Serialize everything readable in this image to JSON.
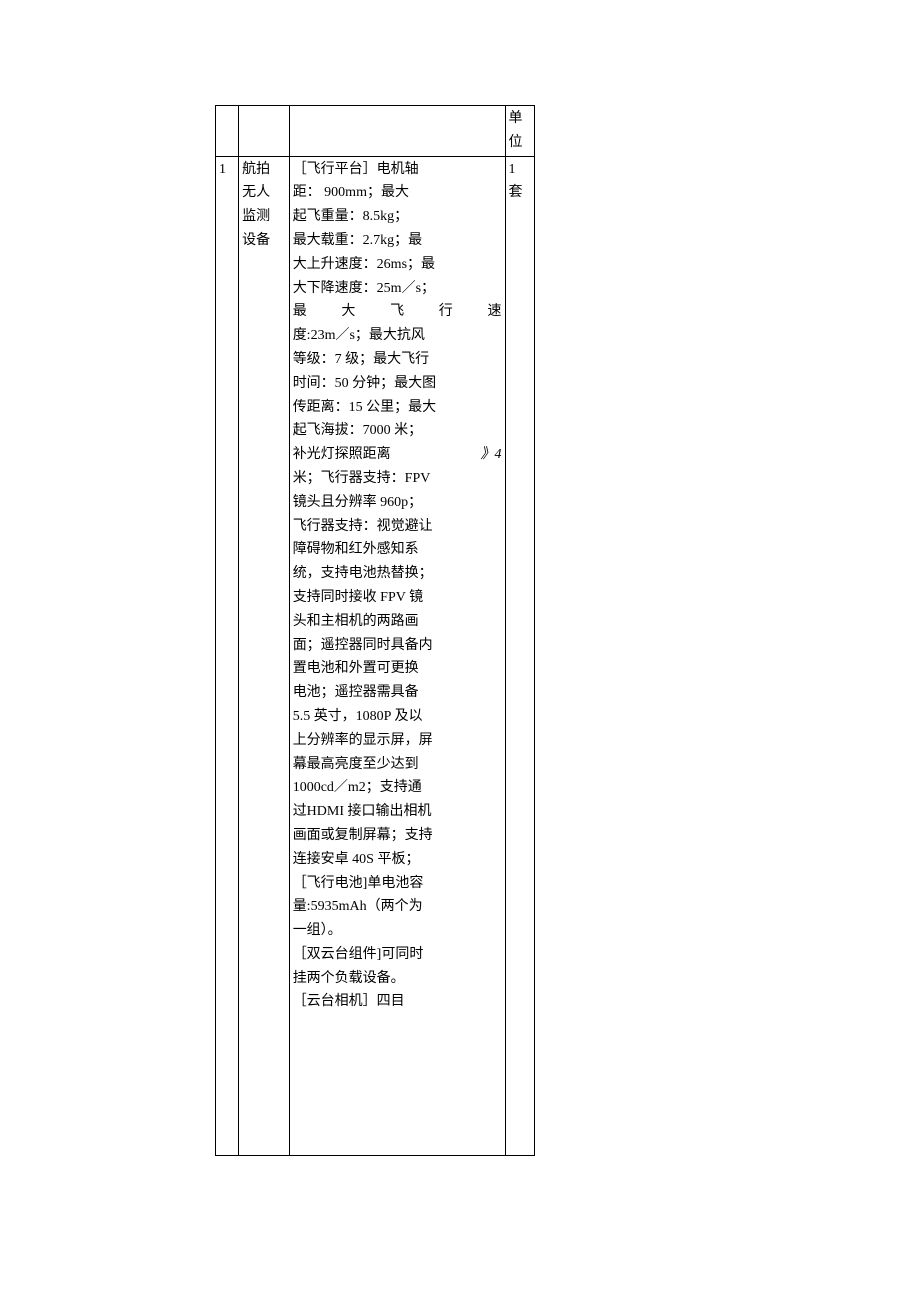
{
  "table": {
    "header": {
      "col4": "单位"
    },
    "rows": [
      {
        "num": "1",
        "name_l1": "航拍",
        "name_l2": "无人",
        "name_l3": "监测",
        "name_l4": "设备",
        "spec_l1": "［飞行平台］电机轴",
        "spec_l2": "距： 900mm；最大",
        "spec_l3": "起飞重量：8.5kg；",
        "spec_l4": "最大载重：2.7kg；最",
        "spec_l5": "大上升速度：26ms；最",
        "spec_l6": "大下降速度：25m／s；",
        "spec_l7a": "最",
        "spec_l7b": "大",
        "spec_l7c": "飞",
        "spec_l7d": "行",
        "spec_l7e": "速",
        "spec_l8": "度:23m／s；最大抗风",
        "spec_l9": "等级：7 级；最大飞行",
        "spec_l10": "时间：50 分钟；最大图",
        "spec_l11": "传距离：15 公里；最大",
        "spec_l12": "起飞海拔：7000 米；",
        "spec_l13a": "补光灯探照距离",
        "spec_l13b": "》4",
        "spec_l14": "米；飞行器支持：FPV",
        "spec_l15": "镜头且分辨率 960p；",
        "spec_l16": "飞行器支持：视觉避让",
        "spec_l17": "障碍物和红外感知系",
        "spec_l18": "统，支持电池热替换；",
        "spec_l19": "支持同时接收 FPV 镜",
        "spec_l20": "头和主相机的两路画",
        "spec_l21": "面；遥控器同时具备内",
        "spec_l22": "置电池和外置可更换",
        "spec_l23": "电池；遥控器需具备",
        "spec_l24": "5.5 英寸，1080P 及以",
        "spec_l25": "上分辨率的显示屏，屏",
        "spec_l26": "幕最高亮度至少达到",
        "spec_l27": "1000cd／m2；支持通",
        "spec_l28": "过HDMI 接口输出相机",
        "spec_l29": "画面或复制屏幕；支持",
        "spec_l30": "连接安卓 40S 平板；",
        "spec_l31": "［飞行电池]单电池容",
        "spec_l32": "量:5935mAh（两个为",
        "spec_l33": "一组）。",
        "spec_l34": "［双云台组件]可同时",
        "spec_l35": "挂两个负载设备。",
        "spec_l36": "［云台相机］四目",
        "unit_l1": "1",
        "unit_l2": "套"
      }
    ]
  }
}
